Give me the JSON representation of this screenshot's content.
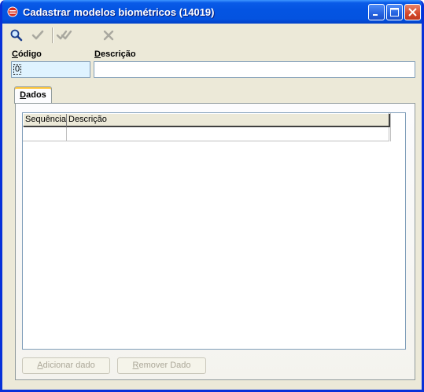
{
  "window": {
    "title": "Cadastrar modelos biométricos (14019)"
  },
  "toolbar": {
    "items": [
      {
        "name": "search",
        "icon": "magnifier-icon",
        "enabled": true
      },
      {
        "name": "confirm",
        "icon": "check-icon",
        "enabled": false
      },
      {
        "name": "confirm-all",
        "icon": "double-check-icon",
        "enabled": false
      },
      {
        "name": "cancel",
        "icon": "x-icon",
        "enabled": false
      }
    ]
  },
  "form": {
    "code_label_first": "C",
    "code_label_rest": "ódigo",
    "code_value": "0",
    "desc_label_first": "D",
    "desc_label_rest": "escrição",
    "desc_value": ""
  },
  "tabs": [
    {
      "first": "D",
      "rest": "ados",
      "active": true
    }
  ],
  "grid": {
    "columns": [
      "Sequência",
      "Descrição"
    ],
    "rows": [
      [
        "",
        ""
      ]
    ]
  },
  "buttons": {
    "add_first": "A",
    "add_rest": "dicionar dado",
    "remove_first": "R",
    "remove_rest": "emover Dado"
  },
  "colors": {
    "title_bar": "#0454E2",
    "window_bg": "#ECE9D8",
    "code_field_bg": "#DFF3FF",
    "tab_highlight": "#FFC73C"
  }
}
